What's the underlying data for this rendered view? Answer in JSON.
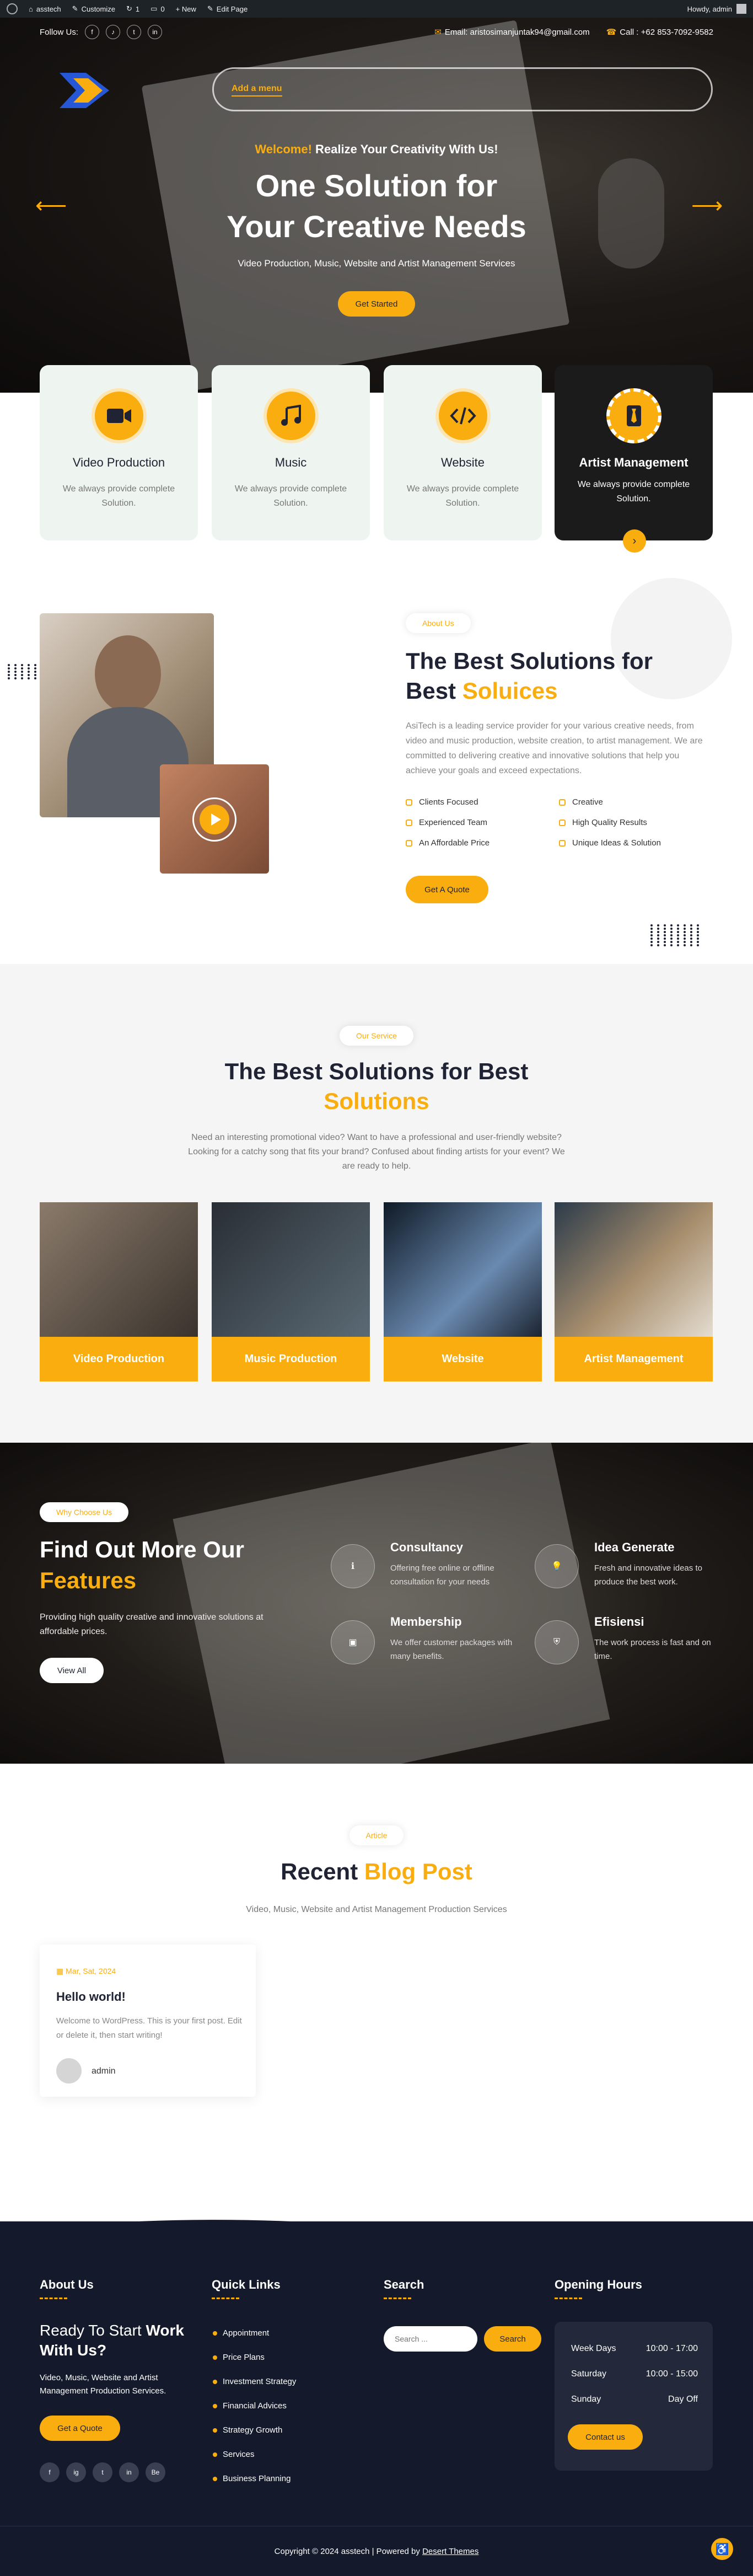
{
  "admin_bar": {
    "site": "asstech",
    "customize": "Customize",
    "comments": "1",
    "notes": "0",
    "new": "+ New",
    "edit": "Edit Page",
    "howdy": "Howdy, admin"
  },
  "topbar": {
    "follow": "Follow Us:",
    "social": [
      "f",
      "♪",
      "t",
      "in"
    ],
    "email": "Email: aristosimanjuntak94@gmail.com",
    "call": "Call : +62 853-7092-9582"
  },
  "nav": {
    "menu": "Add a menu"
  },
  "hero": {
    "welcome_accent": "Welcome!",
    "welcome_rest": " Realize Your Creativity With Us!",
    "title_line1": "One Solution for",
    "title_line2": "Your Creative Needs",
    "subtitle": "Video Production, Music, Website and Artist Management Services",
    "cta": "Get Started"
  },
  "service_cards": [
    {
      "title": "Video Production",
      "desc": "We always provide complete Solution.",
      "icon": "video-camera-icon"
    },
    {
      "title": "Music",
      "desc": "We always provide complete Solution.",
      "icon": "music-note-icon"
    },
    {
      "title": "Website",
      "desc": "We always provide complete Solution.",
      "icon": "code-icon"
    },
    {
      "title": "Artist Management",
      "desc": "We always provide complete Solution.",
      "icon": "tie-icon"
    }
  ],
  "about": {
    "label": "About Us",
    "title_a": "The Best Solutions for Best ",
    "title_b": "Soluices",
    "desc": "AsiTech is a leading service provider for your various creative needs, from video and music production, website creation, to artist management. We are committed to delivering creative and innovative solutions that help you achieve your goals and exceed expectations.",
    "features": [
      "Clients Focused",
      "Creative",
      "Experienced Team",
      "High Quality Results",
      "An Affordable Price",
      "Unique Ideas & Solution"
    ],
    "cta": "Get A Quote"
  },
  "services": {
    "label": "Our Service",
    "title_a": "The Best Solutions for Best",
    "title_b": "Solutions",
    "desc": "Need an interesting promotional video? Want to have a professional and user-friendly website? Looking for a catchy song that fits your brand? Confused about finding artists for your event? We are ready to help.",
    "items": [
      "Video Production",
      "Music Production",
      "Website",
      "Artist Management"
    ]
  },
  "why": {
    "label": "Why Choose Us",
    "title_a": "Find Out More Our",
    "title_b": "Features",
    "desc": "Providing high quality creative and innovative solutions at affordable prices.",
    "cta": "View All",
    "items": [
      {
        "title": "Consultancy",
        "desc": "Offering free online or offline consultation for your needs"
      },
      {
        "title": "Idea Generate",
        "desc": "Fresh and innovative ideas to produce the best work."
      },
      {
        "title": "Membership",
        "desc": "We offer customer packages with many benefits."
      },
      {
        "title": "Efisiensi",
        "desc": "The work process is fast and on time."
      }
    ]
  },
  "blog": {
    "label": "Article",
    "title_a": "Recent ",
    "title_b": "Blog Post",
    "subtitle": "Video, Music, Website and Artist Management Production Services",
    "post": {
      "date": "Mar, Sat, 2024",
      "title": "Hello world!",
      "excerpt": "Welcome to WordPress. This is your first post. Edit or delete it, then start writing!",
      "author": "admin"
    }
  },
  "footer": {
    "about_h": "About Us",
    "about_title_a": "Ready To Start ",
    "about_title_b": "Work",
    "about_title_c": "With Us?",
    "about_desc": "Video, Music, Website and Artist Management Production Services.",
    "about_cta": "Get a Quote",
    "social": [
      "f",
      "ig",
      "t",
      "in",
      "Be"
    ],
    "links_h": "Quick Links",
    "links": [
      "Appointment",
      "Price Plans",
      "Investment Strategy",
      "Financial Advices",
      "Strategy Growth",
      "Services",
      "Business Planning"
    ],
    "search_h": "Search",
    "search_placeholder": "Search ...",
    "search_btn": "Search",
    "hours_h": "Opening Hours",
    "hours": [
      {
        "day": "Week Days",
        "time": "10:00 - 17:00"
      },
      {
        "day": "Saturday",
        "time": "10:00 - 15:00"
      },
      {
        "day": "Sunday",
        "time": "Day Off"
      }
    ],
    "contact_btn": "Contact us",
    "copyright": "Copyright © 2024 asstech | Powered by ",
    "theme_link": "Desert Themes"
  }
}
